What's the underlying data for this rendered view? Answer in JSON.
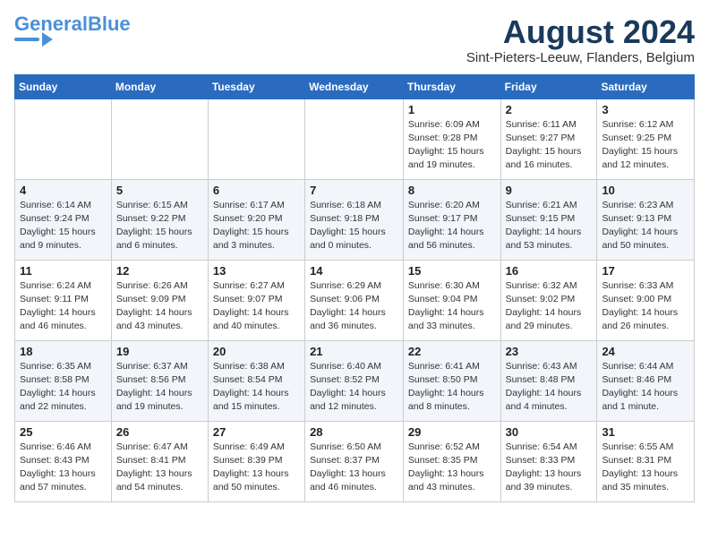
{
  "logo": {
    "line1": "General",
    "line2": "Blue"
  },
  "title": {
    "month_year": "August 2024",
    "location": "Sint-Pieters-Leeuw, Flanders, Belgium"
  },
  "weekdays": [
    "Sunday",
    "Monday",
    "Tuesday",
    "Wednesday",
    "Thursday",
    "Friday",
    "Saturday"
  ],
  "weeks": [
    [
      {
        "day": "",
        "text": ""
      },
      {
        "day": "",
        "text": ""
      },
      {
        "day": "",
        "text": ""
      },
      {
        "day": "",
        "text": ""
      },
      {
        "day": "1",
        "text": "Sunrise: 6:09 AM\nSunset: 9:28 PM\nDaylight: 15 hours\nand 19 minutes."
      },
      {
        "day": "2",
        "text": "Sunrise: 6:11 AM\nSunset: 9:27 PM\nDaylight: 15 hours\nand 16 minutes."
      },
      {
        "day": "3",
        "text": "Sunrise: 6:12 AM\nSunset: 9:25 PM\nDaylight: 15 hours\nand 12 minutes."
      }
    ],
    [
      {
        "day": "4",
        "text": "Sunrise: 6:14 AM\nSunset: 9:24 PM\nDaylight: 15 hours\nand 9 minutes."
      },
      {
        "day": "5",
        "text": "Sunrise: 6:15 AM\nSunset: 9:22 PM\nDaylight: 15 hours\nand 6 minutes."
      },
      {
        "day": "6",
        "text": "Sunrise: 6:17 AM\nSunset: 9:20 PM\nDaylight: 15 hours\nand 3 minutes."
      },
      {
        "day": "7",
        "text": "Sunrise: 6:18 AM\nSunset: 9:18 PM\nDaylight: 15 hours\nand 0 minutes."
      },
      {
        "day": "8",
        "text": "Sunrise: 6:20 AM\nSunset: 9:17 PM\nDaylight: 14 hours\nand 56 minutes."
      },
      {
        "day": "9",
        "text": "Sunrise: 6:21 AM\nSunset: 9:15 PM\nDaylight: 14 hours\nand 53 minutes."
      },
      {
        "day": "10",
        "text": "Sunrise: 6:23 AM\nSunset: 9:13 PM\nDaylight: 14 hours\nand 50 minutes."
      }
    ],
    [
      {
        "day": "11",
        "text": "Sunrise: 6:24 AM\nSunset: 9:11 PM\nDaylight: 14 hours\nand 46 minutes."
      },
      {
        "day": "12",
        "text": "Sunrise: 6:26 AM\nSunset: 9:09 PM\nDaylight: 14 hours\nand 43 minutes."
      },
      {
        "day": "13",
        "text": "Sunrise: 6:27 AM\nSunset: 9:07 PM\nDaylight: 14 hours\nand 40 minutes."
      },
      {
        "day": "14",
        "text": "Sunrise: 6:29 AM\nSunset: 9:06 PM\nDaylight: 14 hours\nand 36 minutes."
      },
      {
        "day": "15",
        "text": "Sunrise: 6:30 AM\nSunset: 9:04 PM\nDaylight: 14 hours\nand 33 minutes."
      },
      {
        "day": "16",
        "text": "Sunrise: 6:32 AM\nSunset: 9:02 PM\nDaylight: 14 hours\nand 29 minutes."
      },
      {
        "day": "17",
        "text": "Sunrise: 6:33 AM\nSunset: 9:00 PM\nDaylight: 14 hours\nand 26 minutes."
      }
    ],
    [
      {
        "day": "18",
        "text": "Sunrise: 6:35 AM\nSunset: 8:58 PM\nDaylight: 14 hours\nand 22 minutes."
      },
      {
        "day": "19",
        "text": "Sunrise: 6:37 AM\nSunset: 8:56 PM\nDaylight: 14 hours\nand 19 minutes."
      },
      {
        "day": "20",
        "text": "Sunrise: 6:38 AM\nSunset: 8:54 PM\nDaylight: 14 hours\nand 15 minutes."
      },
      {
        "day": "21",
        "text": "Sunrise: 6:40 AM\nSunset: 8:52 PM\nDaylight: 14 hours\nand 12 minutes."
      },
      {
        "day": "22",
        "text": "Sunrise: 6:41 AM\nSunset: 8:50 PM\nDaylight: 14 hours\nand 8 minutes."
      },
      {
        "day": "23",
        "text": "Sunrise: 6:43 AM\nSunset: 8:48 PM\nDaylight: 14 hours\nand 4 minutes."
      },
      {
        "day": "24",
        "text": "Sunrise: 6:44 AM\nSunset: 8:46 PM\nDaylight: 14 hours\nand 1 minute."
      }
    ],
    [
      {
        "day": "25",
        "text": "Sunrise: 6:46 AM\nSunset: 8:43 PM\nDaylight: 13 hours\nand 57 minutes."
      },
      {
        "day": "26",
        "text": "Sunrise: 6:47 AM\nSunset: 8:41 PM\nDaylight: 13 hours\nand 54 minutes."
      },
      {
        "day": "27",
        "text": "Sunrise: 6:49 AM\nSunset: 8:39 PM\nDaylight: 13 hours\nand 50 minutes."
      },
      {
        "day": "28",
        "text": "Sunrise: 6:50 AM\nSunset: 8:37 PM\nDaylight: 13 hours\nand 46 minutes."
      },
      {
        "day": "29",
        "text": "Sunrise: 6:52 AM\nSunset: 8:35 PM\nDaylight: 13 hours\nand 43 minutes."
      },
      {
        "day": "30",
        "text": "Sunrise: 6:54 AM\nSunset: 8:33 PM\nDaylight: 13 hours\nand 39 minutes."
      },
      {
        "day": "31",
        "text": "Sunrise: 6:55 AM\nSunset: 8:31 PM\nDaylight: 13 hours\nand 35 minutes."
      }
    ]
  ]
}
